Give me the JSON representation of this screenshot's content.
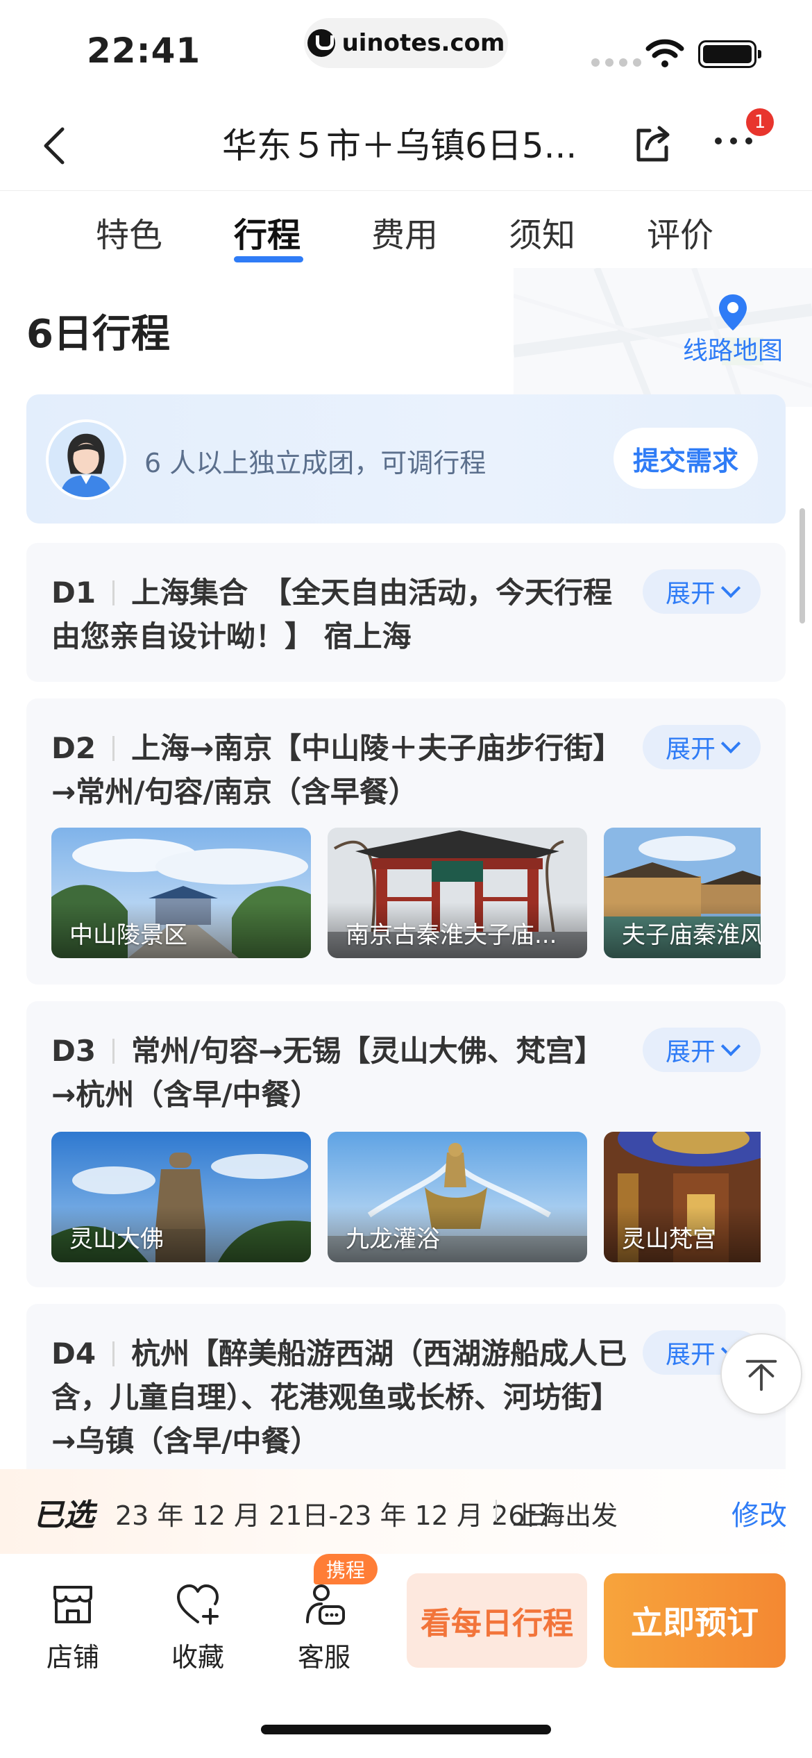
{
  "status_bar": {
    "time": "22:41",
    "url": "uinotes.com"
  },
  "header": {
    "title": "华东５市＋乌镇6日5...",
    "badge_count": "1"
  },
  "tabs": [
    {
      "label": "特色",
      "active": false
    },
    {
      "label": "行程",
      "active": true
    },
    {
      "label": "费用",
      "active": false
    },
    {
      "label": "须知",
      "active": false
    },
    {
      "label": "评价",
      "active": false
    }
  ],
  "itinerary": {
    "title": "6日行程",
    "map_link": "线路地图"
  },
  "banner": {
    "text": "6 人以上独立成团，可调行程",
    "button": "提交需求"
  },
  "days": [
    {
      "label": "D1",
      "text": "上海集合　【全天自由活动，今天行程由您亲自设计呦！】 宿上海",
      "expand": "展开",
      "photos": []
    },
    {
      "label": "D2",
      "text": "上海→南京【中山陵＋夫子庙步行街】→常州/句容/南京（含早餐）",
      "expand": "展开",
      "photos": [
        "中山陵景区",
        "南京古秦淮夫子庙...",
        "夫子庙秦淮风"
      ]
    },
    {
      "label": "D3",
      "text": "常州/句容→无锡【灵山大佛、梵宫】→杭州（含早/中餐）",
      "expand": "展开",
      "photos": [
        "灵山大佛",
        "九龙灌浴",
        "灵山梵宫"
      ]
    },
    {
      "label": "D4",
      "text": "杭州【醉美船游西湖（西湖游船成人已含，儿童自理）、花港观鱼或长桥、河坊街】→乌镇（含早/中餐）",
      "expand": "展开",
      "photos": []
    }
  ],
  "selection": {
    "label": "已选",
    "dates": "23 年 12 月 21日-23 年 12 月 26日",
    "departure": "上海出发",
    "modify": "修改"
  },
  "actions": {
    "shop": "店铺",
    "favorite": "收藏",
    "service": "客服",
    "service_tag": "携程",
    "daily": "看每日行程",
    "book": "立即预订"
  },
  "colors": {
    "accent": "#2f7cf6",
    "orange": "#f48832",
    "badge": "#e8352d"
  }
}
